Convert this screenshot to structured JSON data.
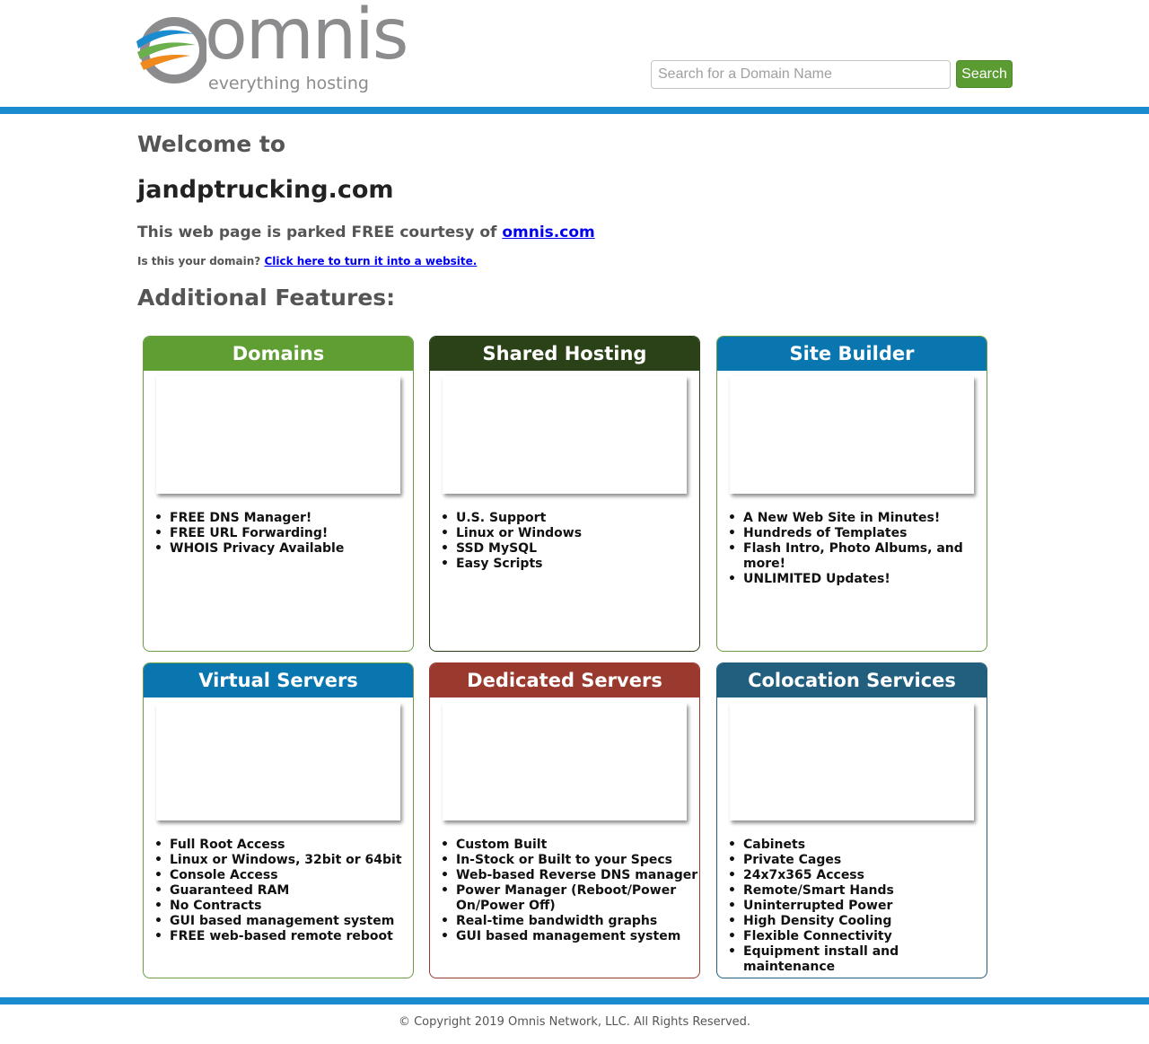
{
  "header": {
    "logo_word": "omnis",
    "logo_tagline": "everything hosting",
    "search": {
      "placeholder": "Search for a Domain Name",
      "value": "",
      "button_label": "Search"
    },
    "colors": {
      "accent_blue": "#1b8bd0",
      "search_green": "#5a9c31",
      "logo_gray": "#8c8c8e",
      "swoosh_blue": "#1b8bd0",
      "swoosh_green": "#6ab04c",
      "swoosh_orange": "#f08a1c"
    }
  },
  "main": {
    "welcome": "Welcome to",
    "domain": "jandptrucking.com",
    "parked_text": "This web page is parked FREE courtesy of ",
    "parked_link": "omnis.com",
    "your_domain_text": "Is this your domain? ",
    "your_domain_link": "Click here to turn it into a website.",
    "features_heading": "Additional Features:",
    "cards": [
      {
        "title": "Domains",
        "header_color": "#5f9e32",
        "border_color": "#6a9c44",
        "items": [
          "FREE DNS Manager!",
          "FREE URL Forwarding!",
          "WHOIS Privacy Available"
        ]
      },
      {
        "title": "Shared Hosting",
        "header_color": "#2b4218",
        "border_color": "#2b4218",
        "items": [
          "U.S. Support",
          "Linux or Windows",
          "SSD MySQL",
          "Easy Scripts"
        ]
      },
      {
        "title": "Site Builder",
        "header_color": "#0a76b0",
        "border_color": "#6a9c44",
        "items": [
          "A New Web Site in Minutes!",
          "Hundreds of Templates",
          "Flash Intro, Photo Albums, and more!",
          "UNLIMITED Updates!"
        ]
      },
      {
        "title": "Virtual Servers",
        "header_color": "#0a76b0",
        "border_color": "#6a9c44",
        "items": [
          "Full Root Access",
          "Linux or Windows, 32bit or 64bit",
          "Console Access",
          "Guaranteed RAM",
          "No Contracts",
          "GUI based management system",
          "FREE web-based remote reboot"
        ]
      },
      {
        "title": "Dedicated Servers",
        "header_color": "#9a3a2e",
        "border_color": "#9a3a2e",
        "items": [
          "Custom Built",
          "In-Stock or Built to your Specs",
          "Web-based Reverse DNS manager",
          "Power Manager (Reboot/Power On/Power Off)",
          "Real-time bandwidth graphs",
          "GUI based management system"
        ]
      },
      {
        "title": "Colocation Services",
        "header_color": "#225f7e",
        "border_color": "#225f7e",
        "items": [
          "Cabinets",
          "Private Cages",
          "24x7x365 Access",
          "Remote/Smart Hands",
          "Uninterrupted Power",
          "High Density Cooling",
          "Flexible Connectivity",
          "Equipment install and maintenance"
        ]
      }
    ]
  },
  "footer": {
    "copyright": "© Copyright 2019 Omnis Network, LLC. All Rights Reserved."
  }
}
